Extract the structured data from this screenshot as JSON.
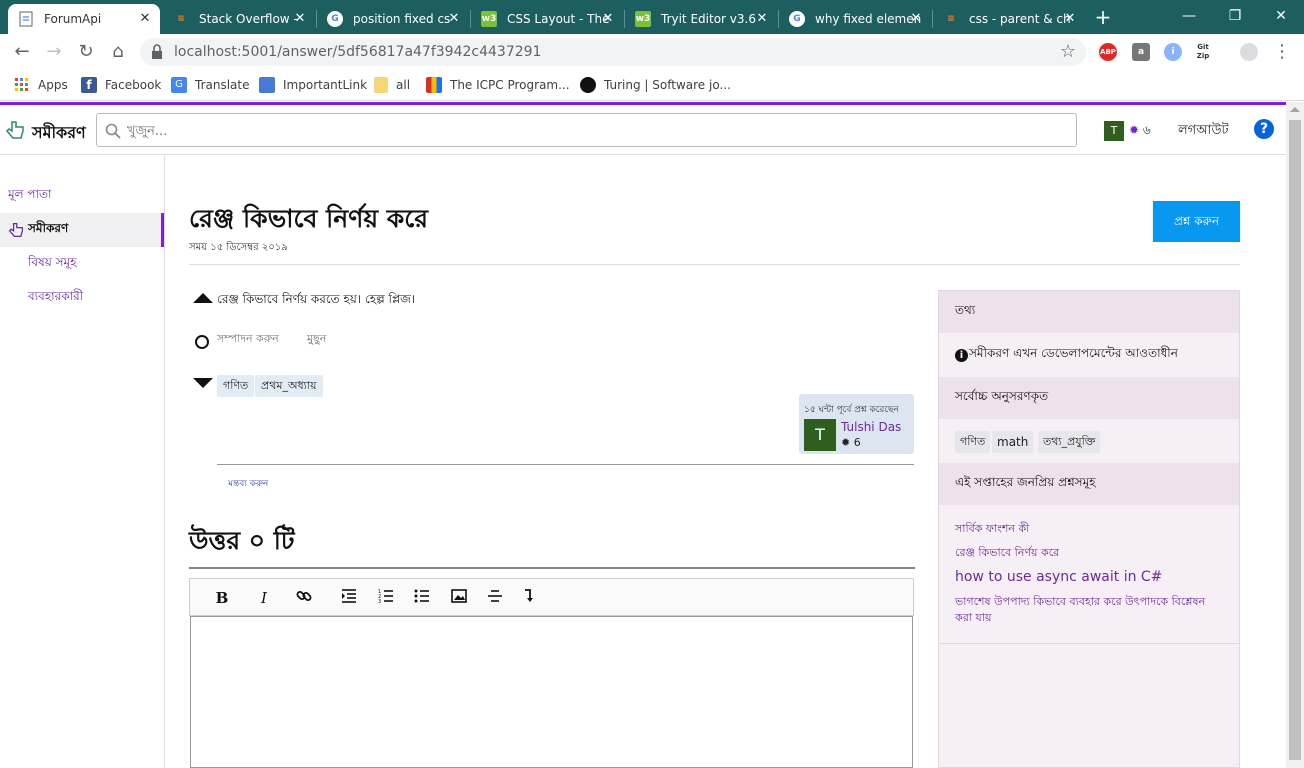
{
  "browser": {
    "tabs": [
      {
        "title": "ForumApi",
        "favicon": "page-icon",
        "active": true
      },
      {
        "title": "Stack Overflow -",
        "favicon": "stackoverflow-icon"
      },
      {
        "title": "position fixed cs",
        "favicon": "google-icon"
      },
      {
        "title": "CSS Layout - The",
        "favicon": "w3schools-icon"
      },
      {
        "title": "Tryit Editor v3.6",
        "favicon": "w3schools-icon"
      },
      {
        "title": "why fixed elemen",
        "favicon": "google-icon"
      },
      {
        "title": "css - parent & ch",
        "favicon": "stackoverflow-icon"
      }
    ],
    "url": "localhost:5001/answer/5df56817a47f3942c4437291",
    "extensions": [
      "ABP",
      "a",
      "i",
      "Git Zip"
    ],
    "bookmarks": [
      "Apps",
      "Facebook",
      "Translate",
      "ImportantLink",
      "all",
      "The ICPC Program...",
      "Turing | Software jo..."
    ]
  },
  "header": {
    "logo_text": "সমীকরণ",
    "search_placeholder": "খুজুন...",
    "user_initial": "T",
    "user_rep": "৬",
    "logout": "লগআউট",
    "help": "?"
  },
  "leftnav": {
    "items": [
      "মূল পাতা",
      "সমীকরণ",
      "বিষয় সমূহ",
      "ব্যবহারকারী"
    ]
  },
  "question": {
    "title": "রেঞ্জ কিভাবে নির্ণয় করে",
    "date_label": "সময়",
    "date": "১৫ ডিসেম্বর ২০১৯",
    "ask_button": "প্রশ্ন করুন",
    "body": "রেঞ্জ কিভাবে নির্ণয় করতে হয়। হেল্প প্লিজ।",
    "edit": "সম্পাদন করুন",
    "delete": "মুছুন",
    "tags": [
      "গণিত",
      "প্রথম_অধ্যায়"
    ],
    "asked_text": "১৫ ঘন্টা পূর্বে প্রশ্ন করেছেন",
    "owner_initial": "T",
    "owner_name": "Tulshi Das",
    "owner_rep": "6",
    "comment_link": "মন্তব্য করুন"
  },
  "answers": {
    "title": "উত্তর ০ টি"
  },
  "sidebar": {
    "info_header": "তথ্য",
    "info_text": "সমীকরণ এখন ডেভেলাপমেন্টের আওতাধীন",
    "followed_header": "সর্বোচ্চ অনুসরণকৃত",
    "followed_tags": [
      "গণিত",
      "math",
      "তথ্য_প্রযুক্তি"
    ],
    "popular_header": "এই সপ্তাহের জনপ্রিয় প্রশ্নসমূহ",
    "popular_links": [
      "সার্বিক ফাংশন কী",
      "রেঞ্জ কিভাবে নির্ণয় করে",
      "how to use async await in C#",
      "ভাগশেষ উপপাদ্য কিভাবে ব্যবহার করে উৎপাদকে বিশ্লেষন করা যায়"
    ]
  }
}
